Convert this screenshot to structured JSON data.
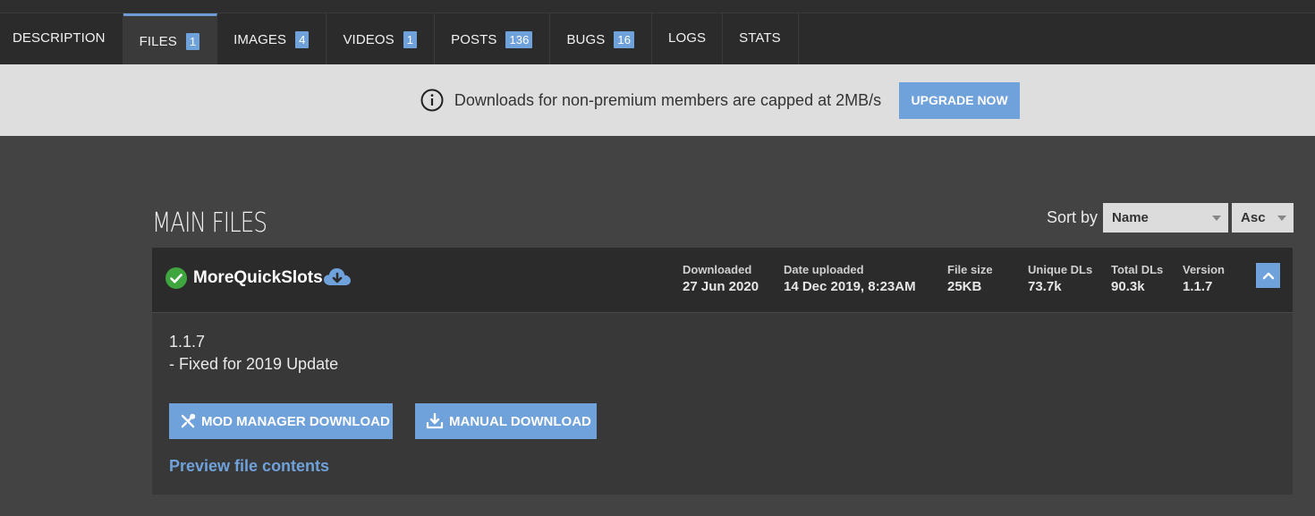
{
  "tabs": [
    {
      "label": "DESCRIPTION",
      "badge": null
    },
    {
      "label": "FILES",
      "badge": "1",
      "active": true
    },
    {
      "label": "IMAGES",
      "badge": "4"
    },
    {
      "label": "VIDEOS",
      "badge": "1"
    },
    {
      "label": "POSTS",
      "badge": "136"
    },
    {
      "label": "BUGS",
      "badge": "16"
    },
    {
      "label": "LOGS",
      "badge": null
    },
    {
      "label": "STATS",
      "badge": null
    }
  ],
  "banner": {
    "text": "Downloads for non-premium members are capped at 2MB/s",
    "button": "UPGRADE NOW",
    "icon": "info-icon"
  },
  "section": {
    "title": "MAIN FILES",
    "sort_label": "Sort by",
    "sort_field": "Name",
    "sort_order": "Asc"
  },
  "file": {
    "name": "MoreQuickSlots",
    "status_icon": "check-circle-icon",
    "download_icon": "cloud-download-icon",
    "meta": [
      {
        "key": "Downloaded",
        "value": "27 Jun 2020"
      },
      {
        "key": "Date uploaded",
        "value": "14 Dec 2019, 8:23AM"
      },
      {
        "key": "File size",
        "value": "25KB"
      },
      {
        "key": "Unique DLs",
        "value": "73.7k"
      },
      {
        "key": "Total DLs",
        "value": "90.3k"
      },
      {
        "key": "Version",
        "value": "1.1.7"
      }
    ],
    "changelog_version": "1.1.7",
    "changelog_note": "- Fixed for 2019 Update",
    "mod_manager_label": "MOD MANAGER DOWNLOAD",
    "manual_label": "MANUAL DOWNLOAD",
    "preview_label": "Preview file contents"
  },
  "colors": {
    "accent": "#6fa1db",
    "success": "#3fa63f",
    "tab_bar": "#2b2b2b",
    "page_bg": "#434343",
    "banner_bg": "#dedede"
  }
}
